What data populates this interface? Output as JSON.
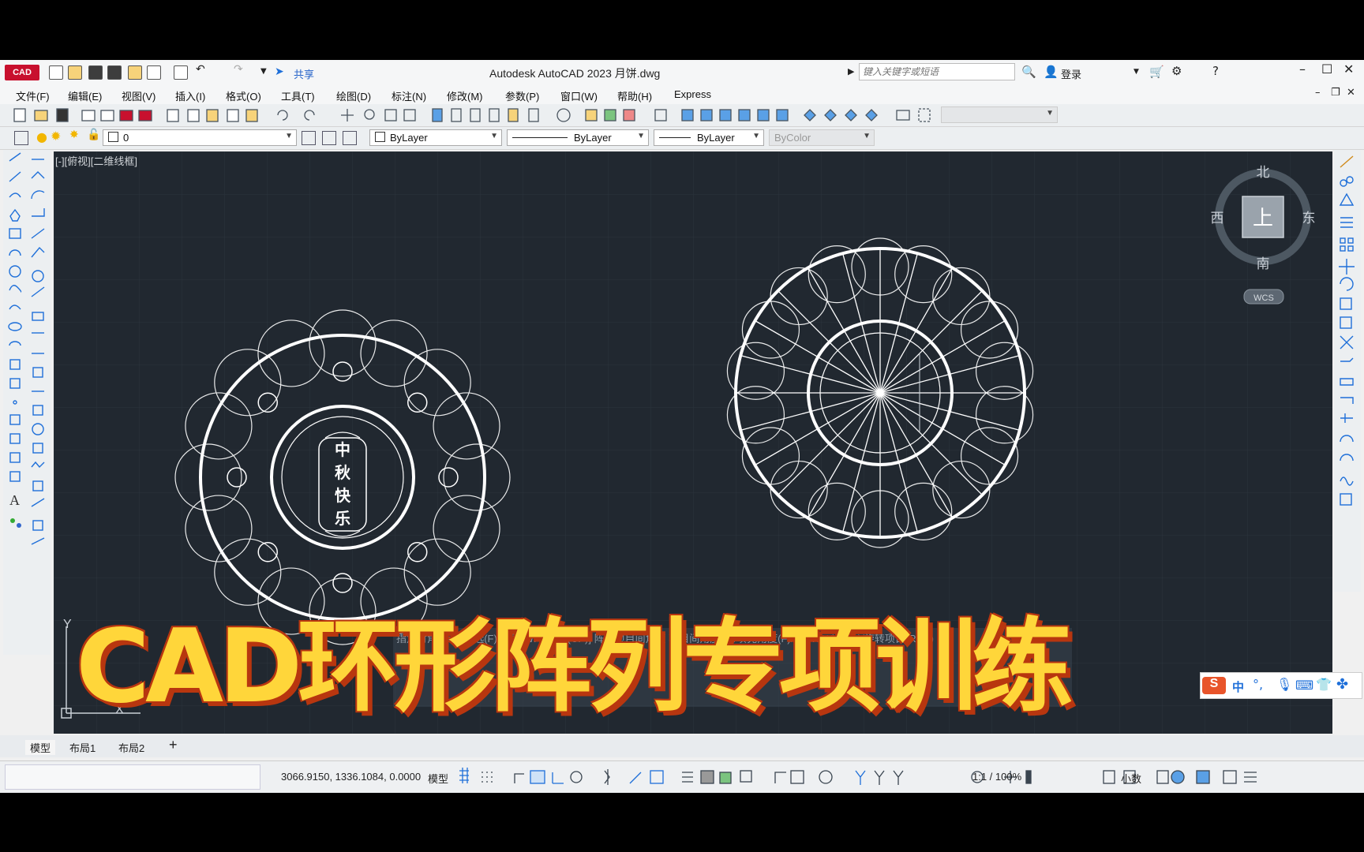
{
  "app": {
    "logo_text": "CAD",
    "share_label": "共享",
    "window_title": "Autodesk AutoCAD 2023    月饼.dwg",
    "search_placeholder": "键入关键字或短语",
    "login_label": "登录"
  },
  "menu": [
    "文件(F)",
    "编辑(E)",
    "视图(V)",
    "插入(I)",
    "格式(O)",
    "工具(T)",
    "绘图(D)",
    "标注(N)",
    "修改(M)",
    "参数(P)",
    "窗口(W)",
    "帮助(H)",
    "Express"
  ],
  "properties": {
    "layer": "0",
    "color": "ByLayer",
    "linetype": "ByLayer",
    "lineweight": "ByLayer",
    "plotstyle": "ByColor"
  },
  "viewport": {
    "label": "[-][俯视][二维线框]",
    "viewcube_top": "上",
    "north": "北",
    "south": "南",
    "east": "东",
    "west": "西",
    "wcs": "WCS",
    "ucs_y": "Y",
    "ucs_x": "X"
  },
  "drawing": {
    "mooncake_text": [
      "中",
      "秋",
      "快",
      "乐"
    ]
  },
  "command_line_partial": "指定对角点或 [栏选(F)/圈围(WP)/圈交(CP)]  阵列项目间角度  项目间角度(A)/填充角度(F)/行(ROW)/层(L)/旋转项目(ROT)",
  "tabs": [
    "模型",
    "布局1",
    "布局2"
  ],
  "status": {
    "coords": "3066.9150, 1336.1084, 0.0000",
    "model_label": "模型",
    "scale": "1:1 / 100%",
    "units": "小数"
  },
  "ime": {
    "label": "中"
  },
  "overlay": {
    "title": "CAD环形阵列专项训练"
  },
  "colors": {
    "canvas_bg": "#212830",
    "overlay_fill": "#ffd63a",
    "overlay_outline": "#b8360f",
    "brand": "#c8102e"
  }
}
